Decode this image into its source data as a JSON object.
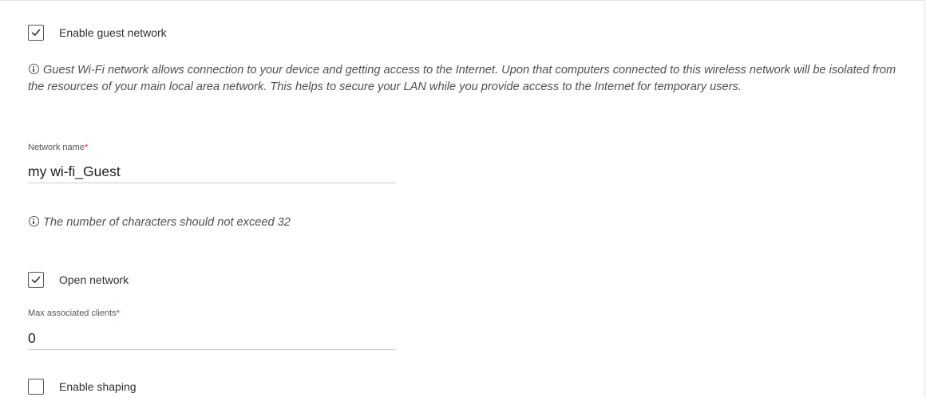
{
  "enable_guest": {
    "label": "Enable guest network",
    "checked": true
  },
  "guest_info": {
    "text": "Guest Wi-Fi network allows connection to your device and getting access to the Internet. Upon that computers connected to this wireless network will be isolated from the resources of your main local area network. This helps to secure your LAN while you provide access to the Internet for temporary users."
  },
  "network_name": {
    "label": "Network name",
    "required_mark": "*",
    "value": "my wi-fi_Guest"
  },
  "char_limit_info": {
    "text": "The number of characters should not exceed 32"
  },
  "open_network": {
    "label": "Open network",
    "checked": true
  },
  "max_clients": {
    "label": "Max associated clients",
    "required_mark": "*",
    "value": "0"
  },
  "enable_shaping": {
    "label": "Enable shaping",
    "checked": false
  },
  "icons": {
    "checkmark": "checkmark-icon",
    "info": "info-icon"
  },
  "colors": {
    "required": "#e0251b",
    "text": "#202020",
    "note": "#505050",
    "border": "#cfcfcf"
  }
}
